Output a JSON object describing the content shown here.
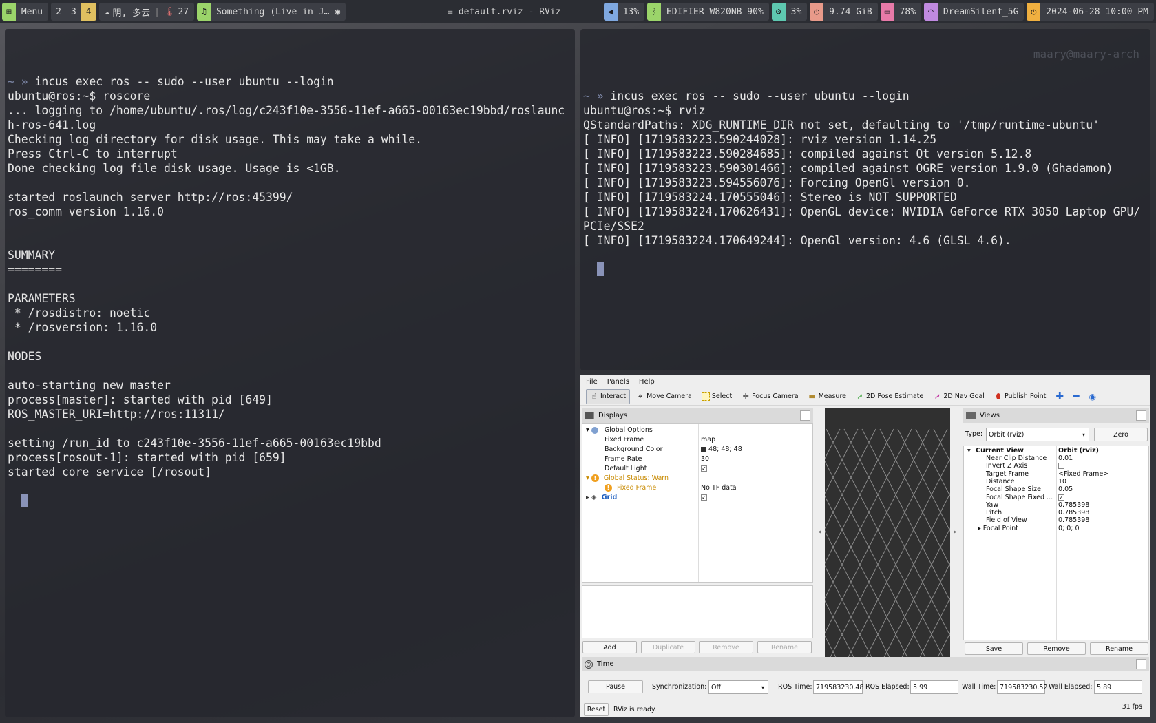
{
  "statusbar": {
    "menu_label": "Menu",
    "workspaces": [
      "2",
      "3",
      "4"
    ],
    "weather": "阴, 多云",
    "temperature": "27",
    "music": "Something (Live in J…",
    "window_title": "default.rviz - RViz",
    "volume": "13%",
    "bluetooth": "EDIFIER W820NB 90%",
    "cpu": "3%",
    "memory": "9.74 GiB",
    "battery": "78%",
    "wifi": "DreamSilent_5G",
    "datetime": "2024-06-28 10:00 PM",
    "colors": {
      "bar": "#2b2d33",
      "green": "#9bd46a",
      "yellow": "#e0c060",
      "blue": "#7fa8e0",
      "teal": "#5ec8b0",
      "salmon": "#e89a8a",
      "pink": "#e87aa8",
      "purple": "#c08ae0",
      "amber": "#f0b040"
    }
  },
  "terminal_left": {
    "lines": [
      "incus exec ros -- sudo --user ubuntu --login",
      "ubuntu@ros:~$ roscore",
      "... logging to /home/ubuntu/.ros/log/c243f10e-3556-11ef-a665-00163ec19bbd/roslaunc",
      "h-ros-641.log",
      "Checking log directory for disk usage. This may take a while.",
      "Press Ctrl-C to interrupt",
      "Done checking log file disk usage. Usage is <1GB.",
      "",
      "started roslaunch server http://ros:45399/",
      "ros_comm version 1.16.0",
      "",
      "",
      "SUMMARY",
      "========",
      "",
      "PARAMETERS",
      " * /rosdistro: noetic",
      " * /rosversion: 1.16.0",
      "",
      "NODES",
      "",
      "auto-starting new master",
      "process[master]: started with pid [649]",
      "ROS_MASTER_URI=http://ros:11311/",
      "",
      "setting /run_id to c243f10e-3556-11ef-a665-00163ec19bbd",
      "process[rosout-1]: started with pid [659]",
      "started core service [/rosout]"
    ]
  },
  "terminal_right": {
    "watermark": "maary@maary-arch",
    "lines": [
      "incus exec ros -- sudo --user ubuntu --login",
      "ubuntu@ros:~$ rviz",
      "QStandardPaths: XDG_RUNTIME_DIR not set, defaulting to '/tmp/runtime-ubuntu'",
      "[ INFO] [1719583223.590244028]: rviz version 1.14.25",
      "[ INFO] [1719583223.590284685]: compiled against Qt version 5.12.8",
      "[ INFO] [1719583223.590301466]: compiled against OGRE version 1.9.0 (Ghadamon)",
      "[ INFO] [1719583223.594556076]: Forcing OpenGl version 0.",
      "[ INFO] [1719583224.170555046]: Stereo is NOT SUPPORTED",
      "[ INFO] [1719583224.170626431]: OpenGL device: NVIDIA GeForce RTX 3050 Laptop GPU/",
      "PCIe/SSE2",
      "[ INFO] [1719583224.170649244]: OpenGl version: 4.6 (GLSL 4.6)."
    ]
  },
  "rviz": {
    "menu": [
      "File",
      "Panels",
      "Help"
    ],
    "tools": [
      "Interact",
      "Move Camera",
      "Select",
      "Focus Camera",
      "Measure",
      "2D Pose Estimate",
      "2D Nav Goal",
      "Publish Point"
    ],
    "displays": {
      "title": "Displays",
      "global_options": "Global Options",
      "fixed_frame_label": "Fixed Frame",
      "fixed_frame_value": "map",
      "background_label": "Background Color",
      "background_value": "48; 48; 48",
      "frame_rate_label": "Frame Rate",
      "frame_rate_value": "30",
      "default_light_label": "Default Light",
      "global_status": "Global Status: Warn",
      "status_fixed_frame": "Fixed Frame",
      "status_fixed_frame_value": "No TF data",
      "grid": "Grid",
      "buttons": [
        "Add",
        "Duplicate",
        "Remove",
        "Rename"
      ]
    },
    "views": {
      "title": "Views",
      "type_label": "Type:",
      "type_value": "Orbit (rviz)",
      "zero": "Zero",
      "current_view": "Current View",
      "current_view_value": "Orbit (rviz)",
      "props": [
        {
          "name": "Near Clip Distance",
          "value": "0.01"
        },
        {
          "name": "Invert Z Axis",
          "value": ""
        },
        {
          "name": "Target Frame",
          "value": "<Fixed Frame>"
        },
        {
          "name": "Distance",
          "value": "10"
        },
        {
          "name": "Focal Shape Size",
          "value": "0.05"
        },
        {
          "name": "Focal Shape Fixed ...",
          "value": ""
        },
        {
          "name": "Yaw",
          "value": "0.785398"
        },
        {
          "name": "Pitch",
          "value": "0.785398"
        },
        {
          "name": "Field of View",
          "value": "0.785398"
        },
        {
          "name": "Focal Point",
          "value": "0; 0; 0"
        }
      ],
      "buttons": [
        "Save",
        "Remove",
        "Rename"
      ]
    },
    "time": {
      "title": "Time",
      "pause": "Pause",
      "sync_label": "Synchronization:",
      "sync_value": "Off",
      "ros_time_label": "ROS Time:",
      "ros_time": "719583230.48",
      "ros_elapsed_label": "ROS Elapsed:",
      "ros_elapsed": "5.99",
      "wall_time_label": "Wall Time:",
      "wall_time": "719583230.52",
      "wall_elapsed_label": "Wall Elapsed:",
      "wall_elapsed": "5.89"
    },
    "status": {
      "reset": "Reset",
      "message": "RViz is ready.",
      "fps": "31 fps"
    }
  }
}
